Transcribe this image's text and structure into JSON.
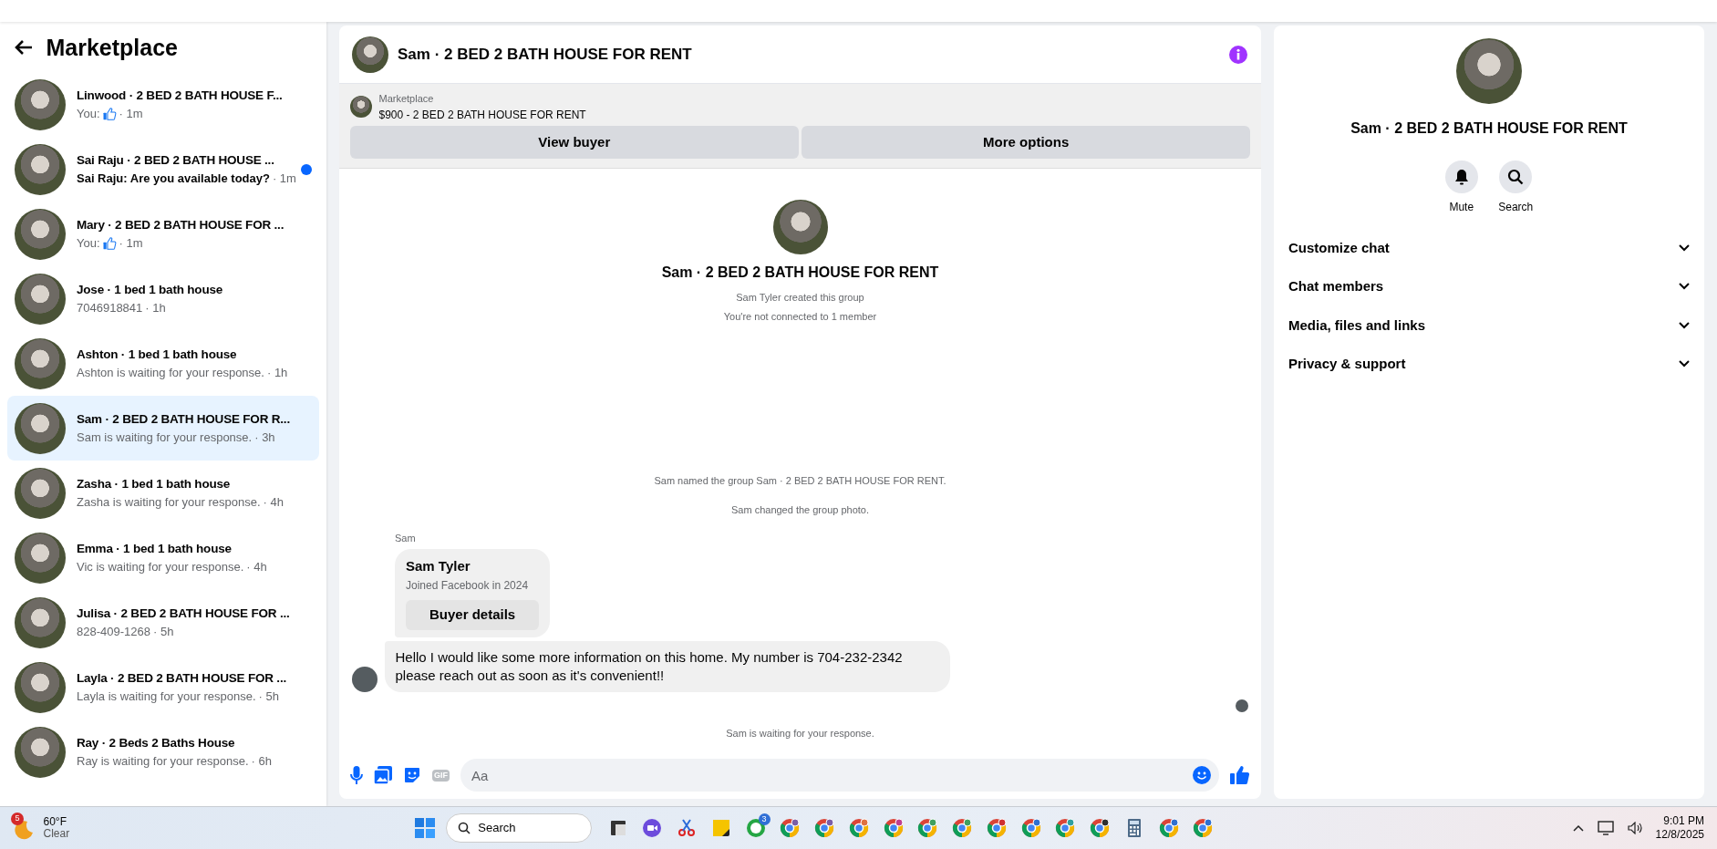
{
  "sidebar": {
    "title": "Marketplace",
    "conversations": [
      {
        "name": "Linwood · 2 BED 2 BATH HOUSE F...",
        "preview": "You:",
        "like_icon": true,
        "time": "· 1m",
        "unread": false,
        "selected": false
      },
      {
        "name": "Sai Raju · 2 BED 2 BATH HOUSE ...",
        "preview": "Sai Raju: Are you available today?",
        "like_icon": false,
        "time": "· 1m",
        "unread": true,
        "selected": false
      },
      {
        "name": "Mary · 2 BED 2 BATH HOUSE FOR ...",
        "preview": "You:",
        "like_icon": true,
        "time": "· 1m",
        "unread": false,
        "selected": false
      },
      {
        "name": "Jose · 1 bed 1 bath house",
        "preview": "7046918841",
        "like_icon": false,
        "time": "· 1h",
        "unread": false,
        "selected": false
      },
      {
        "name": "Ashton · 1 bed 1 bath house",
        "preview": "Ashton is waiting for your response.",
        "like_icon": false,
        "time": "· 1h",
        "unread": false,
        "selected": false
      },
      {
        "name": "Sam · 2 BED 2 BATH HOUSE FOR R...",
        "preview": "Sam is waiting for your response.",
        "like_icon": false,
        "time": "· 3h",
        "unread": false,
        "selected": true
      },
      {
        "name": "Zasha · 1 bed 1 bath house",
        "preview": "Zasha is waiting for your response.",
        "like_icon": false,
        "time": "· 4h",
        "unread": false,
        "selected": false
      },
      {
        "name": "Emma · 1 bed 1 bath house",
        "preview": "Vic is waiting for your response.",
        "like_icon": false,
        "time": "· 4h",
        "unread": false,
        "selected": false
      },
      {
        "name": "Julisa · 2 BED 2 BATH HOUSE FOR ...",
        "preview": "828-409-1268",
        "like_icon": false,
        "time": "· 5h",
        "unread": false,
        "selected": false
      },
      {
        "name": "Layla · 2 BED 2 BATH HOUSE FOR ...",
        "preview": "Layla is waiting for your response.",
        "like_icon": false,
        "time": "· 5h",
        "unread": false,
        "selected": false
      },
      {
        "name": "Ray · 2 Beds 2 Baths House",
        "preview": "Ray is waiting for your response.",
        "like_icon": false,
        "time": "· 6h",
        "unread": false,
        "selected": false
      }
    ]
  },
  "chat": {
    "title": "Sam · 2 BED 2 BATH HOUSE FOR RENT",
    "listing": {
      "label": "Marketplace",
      "title": "$900 - 2 BED 2 BATH HOUSE FOR RENT",
      "buttons": [
        "View buyer",
        "More options"
      ]
    },
    "intro": {
      "title": "Sam · 2 BED 2 BATH HOUSE FOR RENT",
      "lines": [
        "Sam Tyler created this group",
        "You're not connected to 1 member"
      ]
    },
    "events": [
      "Sam named the group Sam · 2 BED 2 BATH HOUSE FOR RENT.",
      "Sam changed the group photo."
    ],
    "sender": "Sam",
    "profile_card": {
      "name": "Sam Tyler",
      "subtitle": "Joined Facebook in 2024",
      "button": "Buyer details"
    },
    "message": "Hello I would like some more information on this home. My number is 704-232-2342 please reach out as soon as it's convenient!!",
    "status": "Sam is waiting for your response.",
    "composer": {
      "gif": "GIF",
      "placeholder": "Aa"
    }
  },
  "details": {
    "title": "Sam · 2 BED 2 BATH HOUSE FOR RENT",
    "actions": [
      {
        "kind": "bell",
        "label": "Mute"
      },
      {
        "kind": "search",
        "label": "Search"
      }
    ],
    "sections": [
      {
        "label": "Customize chat",
        "expanded": false
      },
      {
        "label": "Chat members",
        "expanded": false
      },
      {
        "label": "Media, files and links",
        "expanded": false
      },
      {
        "label": "Privacy & support",
        "expanded": false
      }
    ]
  },
  "taskbar": {
    "weather": {
      "badge": "5",
      "temp": "60°F",
      "condition": "Clear"
    },
    "search": "Search",
    "apps": [
      {
        "kind": "taskview"
      },
      {
        "kind": "meet"
      },
      {
        "kind": "snip"
      },
      {
        "kind": "notes"
      },
      {
        "kind": "whatsapp",
        "badge": "3"
      },
      {
        "kind": "chrome",
        "color": "#7b5ea7"
      },
      {
        "kind": "chrome",
        "color": "#7b5ea7"
      },
      {
        "kind": "chrome",
        "color": "#e07040"
      },
      {
        "kind": "chrome",
        "color": "#c04090"
      },
      {
        "kind": "chrome",
        "color": "#40a060"
      },
      {
        "kind": "chrome",
        "color": "#40a060"
      },
      {
        "kind": "chrome",
        "color": "#d03030"
      },
      {
        "kind": "chrome",
        "color": "#3070d0"
      },
      {
        "kind": "chrome",
        "color": "#30a0a0"
      },
      {
        "kind": "chrome",
        "color": "#303030"
      },
      {
        "kind": "calc"
      },
      {
        "kind": "chrome",
        "color": "#3070d0"
      },
      {
        "kind": "chrome",
        "color": "#3070d0"
      }
    ],
    "time": "9:01 PM",
    "date": "12/8/2025"
  }
}
